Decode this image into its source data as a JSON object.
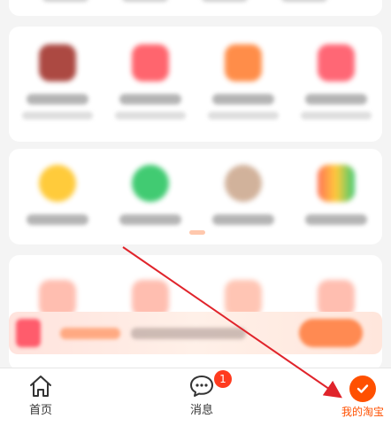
{
  "colors": {
    "accent": "#ff5000",
    "badge": "#ff3b1f",
    "annotation_arrow": "#e0242b"
  },
  "grid_icons_row1": [
    {
      "icon": "blurred-dark-red-icon",
      "color": "#9e2a22"
    },
    {
      "icon": "blurred-red-icon",
      "color": "#ff4b55"
    },
    {
      "icon": "blurred-orange-icon",
      "color": "#ff7a2a"
    },
    {
      "icon": "blurred-pink-red-icon",
      "color": "#ff4d5e"
    }
  ],
  "grid_icons_row2": [
    {
      "icon": "blurred-yellow-icon",
      "color": "#ffc21a"
    },
    {
      "icon": "blurred-green-icon",
      "color": "#20c25a"
    },
    {
      "icon": "blurred-avatar-icon",
      "color": "#caa58a"
    },
    {
      "icon": "blurred-multicolor-icon",
      "color": "#ff6a3a"
    }
  ],
  "grid_icons_row3": [
    {
      "icon": "blurred-peach-icon",
      "color": "#ffb3a3"
    },
    {
      "icon": "blurred-peach-icon",
      "color": "#ffb3a3"
    },
    {
      "icon": "blurred-peach-icon",
      "color": "#ffbca8"
    },
    {
      "icon": "blurred-peach-icon",
      "color": "#ffb3a3"
    }
  ],
  "tabbar": {
    "home": {
      "label": "首页",
      "icon": "home-icon"
    },
    "messages": {
      "label": "消息",
      "icon": "chat-bubble-icon",
      "badge": "1"
    },
    "my_taobao": {
      "label": "我的淘宝",
      "icon": "checkmark-circle-icon"
    }
  }
}
